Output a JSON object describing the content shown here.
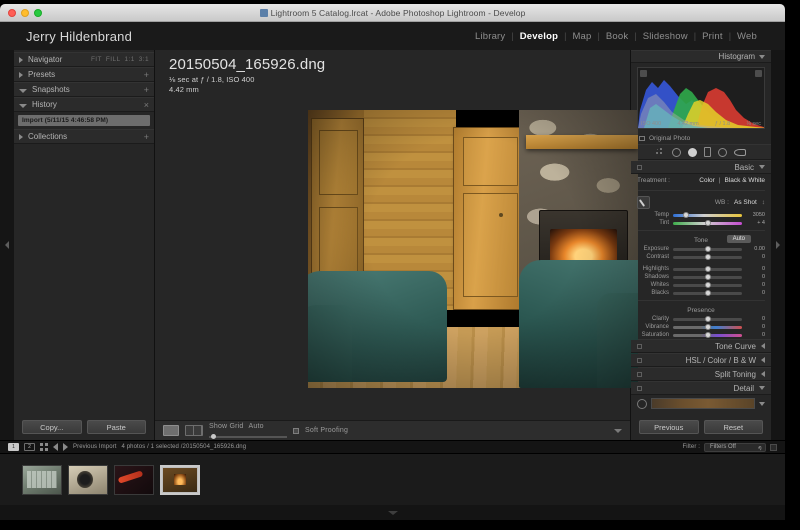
{
  "window": {
    "title": "Lightroom 5 Catalog.lrcat - Adobe Photoshop Lightroom - Develop",
    "traffic_lights": [
      "close",
      "minimize",
      "zoom"
    ]
  },
  "identity": "Jerry Hildenbrand",
  "modules": [
    {
      "label": "Library",
      "active": false
    },
    {
      "label": "Develop",
      "active": true
    },
    {
      "label": "Map",
      "active": false
    },
    {
      "label": "Book",
      "active": false
    },
    {
      "label": "Slideshow",
      "active": false
    },
    {
      "label": "Print",
      "active": false
    },
    {
      "label": "Web",
      "active": false
    }
  ],
  "module_separator": "|",
  "left_panel": {
    "navigator": {
      "title": "Navigator",
      "zoom_options": [
        "FIT",
        "FILL",
        "1:1",
        "3:1"
      ]
    },
    "presets": {
      "title": "Presets",
      "add": "+"
    },
    "snapshots": {
      "title": "Snapshots",
      "add": "+"
    },
    "history": {
      "title": "History",
      "clear": "×",
      "items": [
        "Import (5/11/15 4:46:58 PM)"
      ]
    },
    "collections": {
      "title": "Collections",
      "add": "+"
    },
    "buttons": {
      "copy": "Copy...",
      "paste": "Paste"
    }
  },
  "photo": {
    "filename": "20150504_165926.dng",
    "exposure_line": "⅛ sec at ƒ / 1.8, ISO 400",
    "focal_line": "4.42 mm"
  },
  "center_toolbar": {
    "show_grid_label": "Show Grid",
    "grid_mode": "Auto",
    "soft_proofing_label": "Soft Proofing"
  },
  "right_panel": {
    "histogram": {
      "title": "Histogram",
      "iso": "ISO 400",
      "focal": "4.42 mm",
      "aperture": "ƒ / 1.8",
      "shutter": "⅛ sec"
    },
    "original_photo_label": "Original Photo",
    "tools": [
      "crop-overlay",
      "spot-removal",
      "red-eye",
      "graduated-filter",
      "radial-filter",
      "adjustment-brush"
    ],
    "basic": {
      "title": "Basic",
      "treatment_label": "Treatment :",
      "treatment_color": "Color",
      "treatment_bw": "Black & White",
      "wb_label": "WB :",
      "wb_value": "As Shot",
      "temp_label": "Temp",
      "temp_value": "3050",
      "tint_label": "Tint",
      "tint_value": "+ 4",
      "tone_label": "Tone",
      "auto_label": "Auto",
      "tone_sliders": [
        {
          "label": "Exposure",
          "value": "0.00"
        },
        {
          "label": "Contrast",
          "value": "0"
        },
        {
          "label": "Highlights",
          "value": "0"
        },
        {
          "label": "Shadows",
          "value": "0"
        },
        {
          "label": "Whites",
          "value": "0"
        },
        {
          "label": "Blacks",
          "value": "0"
        }
      ],
      "presence_label": "Presence",
      "presence_sliders": [
        {
          "label": "Clarity",
          "value": "0"
        },
        {
          "label": "Vibrance",
          "value": "0"
        },
        {
          "label": "Saturation",
          "value": "0"
        }
      ]
    },
    "sections": [
      {
        "title": "Tone Curve"
      },
      {
        "title": "HSL / Color / B & W"
      },
      {
        "title": "Split Toning"
      },
      {
        "title": "Detail"
      }
    ],
    "buttons": {
      "previous": "Previous",
      "reset": "Reset"
    }
  },
  "filmstrip_bar": {
    "screen1": "1",
    "screen2": "2",
    "source": "Previous Import",
    "status": "4 photos / 1 selected /20150504_165926.dng",
    "filter_label": "Filter :",
    "filter_value": "Filters Off"
  },
  "filmstrip": {
    "thumbs": [
      {
        "name": "keyboard-photo",
        "selected": false
      },
      {
        "name": "lens-photo",
        "selected": false
      },
      {
        "name": "red-object-photo",
        "selected": false
      },
      {
        "name": "fireplace-photo",
        "selected": true
      }
    ]
  },
  "colors": {
    "app_bg": "#262626",
    "panel_bg": "#2b2b2b",
    "accent_text": "#ffffff",
    "muted_text": "#9a9a9a"
  }
}
